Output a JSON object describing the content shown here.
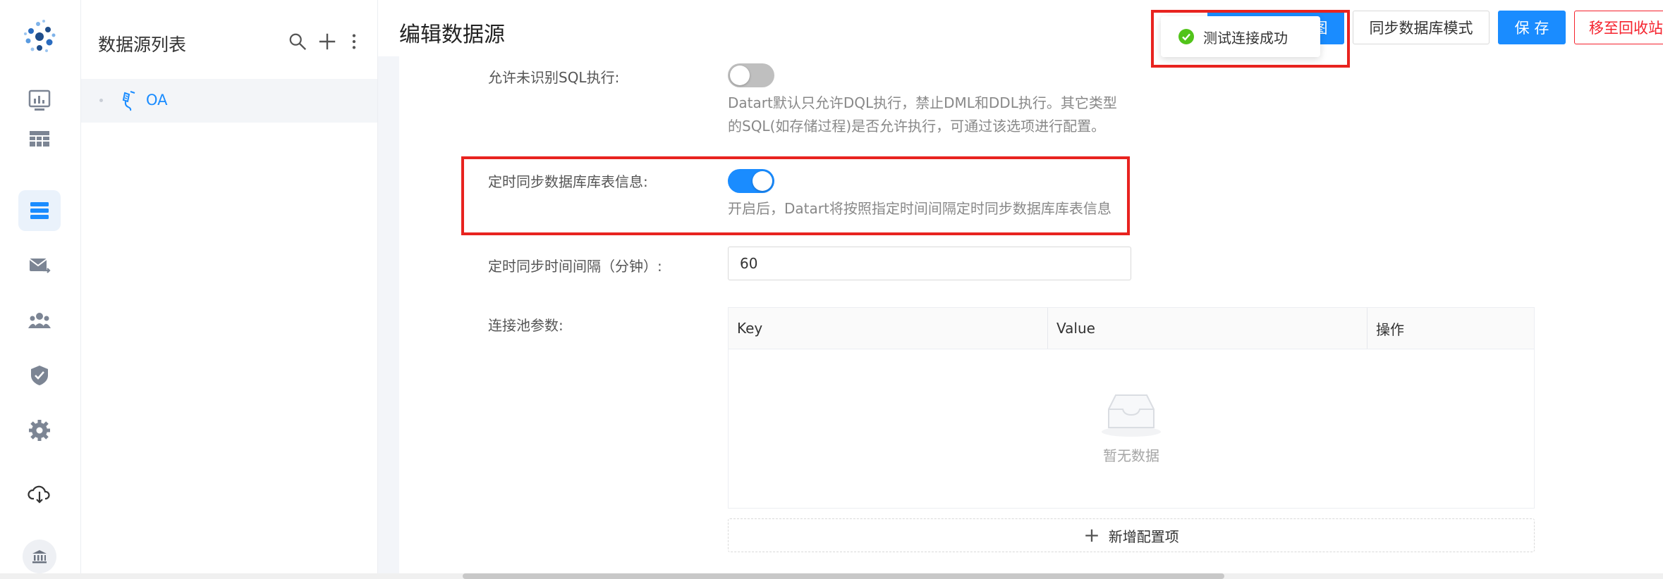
{
  "nav": {
    "items": [
      {
        "name": "dashboard-icon"
      },
      {
        "name": "table-view-icon"
      },
      {
        "name": "datasource-icon",
        "active": true
      },
      {
        "name": "schedule-mail-icon"
      },
      {
        "name": "members-icon"
      },
      {
        "name": "permission-icon"
      },
      {
        "name": "settings-icon"
      },
      {
        "name": "download-icon"
      }
    ]
  },
  "listpanel": {
    "title": "数据源列表",
    "items": [
      {
        "label": "OA"
      }
    ]
  },
  "header": {
    "title": "编辑数据源",
    "buttons": {
      "new_view": "去新建数据视图",
      "sync_schema": "同步数据库模式",
      "save": "保 存",
      "recycle": "移至回收站"
    }
  },
  "toast": {
    "message": "测试连接成功"
  },
  "form": {
    "allow_sql": {
      "label": "允许未识别SQL执行:",
      "enabled": false,
      "help_line1": "Datart默认只允许DQL执行，禁止DML和DDL执行。其它类型",
      "help_line2": "的SQL(如存储过程)是否允许执行，可通过该选项进行配置。"
    },
    "sync_tables": {
      "label": "定时同步数据库库表信息:",
      "enabled": true,
      "help": "开启后，Datart将按照指定时间间隔定时同步数据库库表信息"
    },
    "sync_interval": {
      "label": "定时同步时间间隔（分钟）:",
      "value": "60"
    },
    "pool_params": {
      "label": "连接池参数:",
      "columns": [
        "Key",
        "Value",
        "操作"
      ],
      "empty_text": "暂无数据",
      "add_label": "新增配置项"
    }
  },
  "colors": {
    "accent": "#1a8cff",
    "danger": "#f5222d",
    "highlight": "#e8231f",
    "success": "#52c41a"
  }
}
